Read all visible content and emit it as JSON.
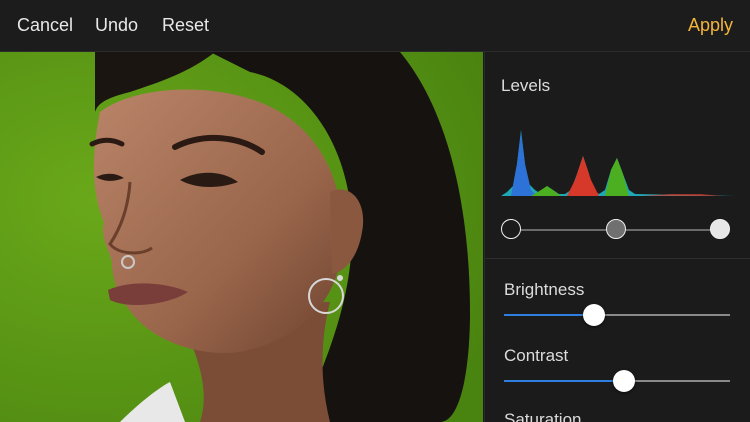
{
  "toolbar": {
    "cancel": "Cancel",
    "undo": "Undo",
    "reset": "Reset",
    "apply": "Apply"
  },
  "accent_color": "#f2b53a",
  "slider_fill_color": "#2f7fe0",
  "panel": {
    "levels_title": "Levels",
    "levels_handles": {
      "black": 0.0,
      "mid": 0.5,
      "white": 1.0
    },
    "sliders": [
      {
        "label": "Brightness",
        "value": 0.4
      },
      {
        "label": "Contrast",
        "value": 0.53
      },
      {
        "label": "Saturation"
      }
    ]
  },
  "photo": {
    "background_color": "#5d9b14"
  }
}
